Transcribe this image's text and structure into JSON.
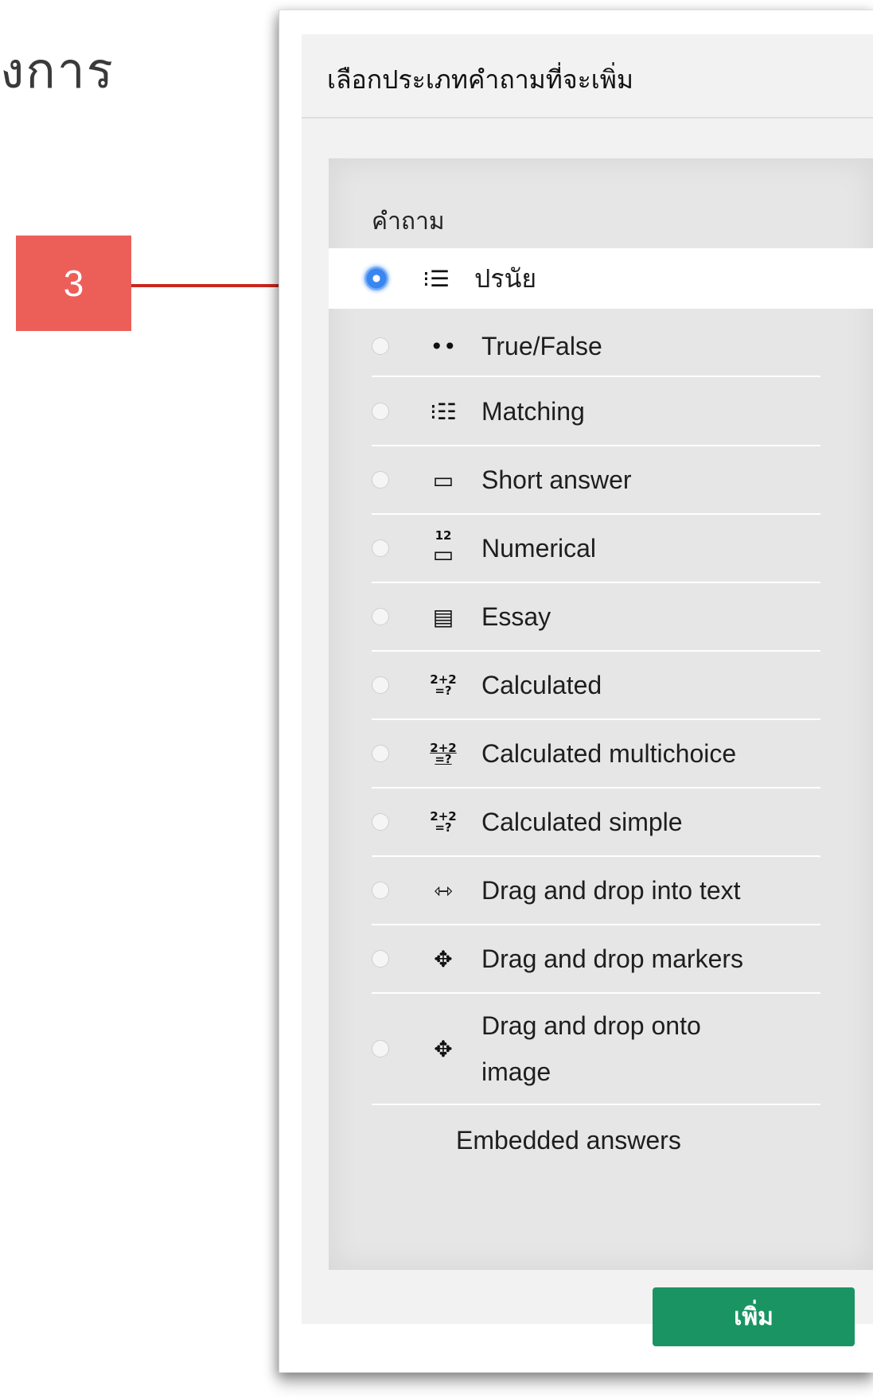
{
  "background": {
    "heading": "งการ"
  },
  "callout": {
    "number": "3"
  },
  "dialog": {
    "title": "เลือกประเภทคำถามที่จะเพิ่ม",
    "group_label": "คำถาม",
    "items": [
      {
        "label": "ปรนัย",
        "icon": "multichoice-icon",
        "selected": true
      },
      {
        "label": "True/False",
        "icon": "truefalse-icon"
      },
      {
        "label": "Matching",
        "icon": "matching-icon"
      },
      {
        "label": "Short answer",
        "icon": "short-answer-icon"
      },
      {
        "label": "Numerical",
        "icon": "numerical-icon"
      },
      {
        "label": "Essay",
        "icon": "essay-icon"
      },
      {
        "label": "Calculated",
        "icon": "calculated-icon"
      },
      {
        "label": "Calculated multichoice",
        "icon": "calculated-multichoice-icon"
      },
      {
        "label": "Calculated simple",
        "icon": "calculated-simple-icon"
      },
      {
        "label": "Drag and drop into text",
        "icon": "drag-drop-text-icon"
      },
      {
        "label": "Drag and drop markers",
        "icon": "drag-drop-markers-icon"
      },
      {
        "label": "Drag and drop onto image",
        "icon": "drag-drop-image-icon"
      },
      {
        "label": "Embedded answers",
        "icon": "embedded-answers-icon"
      }
    ],
    "add_button": "เพิ่ม"
  },
  "colors": {
    "accent_green": "#1a9462",
    "callout_red": "#ec5f58",
    "arrow": "#c8281e",
    "radio_selected": "#3a86f0"
  }
}
